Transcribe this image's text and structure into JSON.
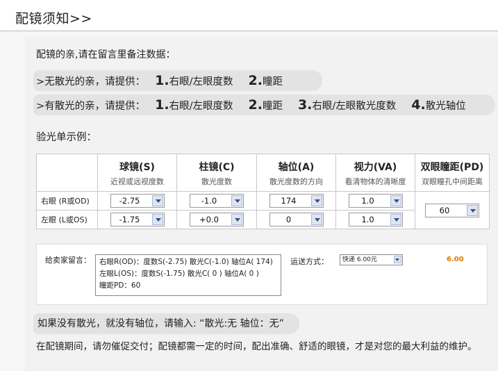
{
  "header": {
    "title": "配镜须知>>"
  },
  "intro": "配镜的亲,请在留言里备注数据：",
  "no_astig": {
    "prefix": ">无散光的亲，请提供：",
    "items": [
      {
        "num": "1.",
        "text": "右眼/左眼度数"
      },
      {
        "num": "2.",
        "text": "瞳距"
      }
    ]
  },
  "astig": {
    "prefix": ">有散光的亲，请提供：",
    "items": [
      {
        "num": "1.",
        "text": "右眼/左眼度数"
      },
      {
        "num": "2.",
        "text": "瞳距"
      },
      {
        "num": "3.",
        "text": "右眼/左眼散光度数"
      },
      {
        "num": "4.",
        "text": "散光轴位"
      }
    ]
  },
  "example_label": "验光单示例：",
  "table": {
    "columns": [
      {
        "title": "球镜(S)",
        "sub": "近视或远视度数"
      },
      {
        "title": "柱镜(C)",
        "sub": "散光度数"
      },
      {
        "title": "轴位(A)",
        "sub": "散光度数的方向"
      },
      {
        "title": "视力(VA)",
        "sub": "看清物体的清晰度"
      },
      {
        "title": "双眼瞳距(PD)",
        "sub": "双眼瞳孔中间距离"
      }
    ],
    "rows": [
      {
        "label": "右眼 (R或OD)",
        "sphere": "-2.75",
        "cylinder": "-1.0",
        "axis": "174",
        "va": "1.0"
      },
      {
        "label": "左眼 (L或OS)",
        "sphere": "-1.75",
        "cylinder": "+0.0",
        "axis": "0",
        "va": "1.0"
      }
    ],
    "pd": "60"
  },
  "note": {
    "label": "给卖家留言：",
    "text": "右眼R(OD)：度数S(-2.75)  散光C(-1.0)  轴位A( 174)\n左眼L(OS)：度数S(-1.75)  散光C( 0 )     轴位A( 0 )\n瞳距PD：60",
    "ship_label": "运送方式：",
    "ship_value": "快递 6.00元",
    "price": "6.00"
  },
  "warning": "如果没有散光，就没有轴位，请输入: “散光:无    轴位：无”",
  "footer": "在配镜期间，请勿催促交付；配镜都需一定的时间，配出准确、舒适的眼镜，才是对您的最大利益的维护。",
  "colors": {
    "pill_bg": "#e3e3e3",
    "price": "#e07a00",
    "select_arrow": "#dde6f4"
  }
}
